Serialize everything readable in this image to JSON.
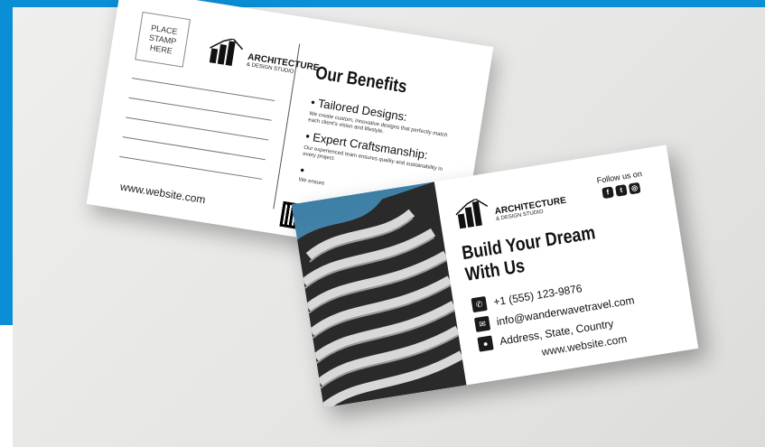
{
  "back_card": {
    "stamp_text": "PLACE\nSTAMP\nHERE",
    "logo_title": "ARCHITECTURE",
    "logo_subtitle": "& DESIGN STUDIO",
    "benefits_title": "Our Benefits",
    "benefit_1_title": "Tailored Designs:",
    "benefit_1_text": "We create custom, innovative designs that perfectly match each client's vision and lifestyle.",
    "benefit_2_title": "Expert Craftsmanship:",
    "benefit_2_text": "Our experienced team ensures quality and sustainability in every project.",
    "benefit_3_text": "We ensure",
    "website": "www.website.com"
  },
  "front_card": {
    "logo_title": "ARCHITECTURE",
    "logo_subtitle": "& DESIGN STUDIO",
    "follow_label": "Follow us on",
    "social_icons": [
      "facebook-icon",
      "twitter-icon",
      "instagram-icon"
    ],
    "headline_line1": "Build Your Dream",
    "headline_line2": "With Us",
    "phone": "+1 (555) 123-9876",
    "email": "info@wanderwavetravel.com",
    "address": "Address, State, Country",
    "website": "www.website.com"
  },
  "colors": {
    "background_accent": "#0a8fd6",
    "paper": "#e8e8e6",
    "card": "#ffffff",
    "text_dark": "#111111",
    "sky": "#3d7fa6"
  }
}
